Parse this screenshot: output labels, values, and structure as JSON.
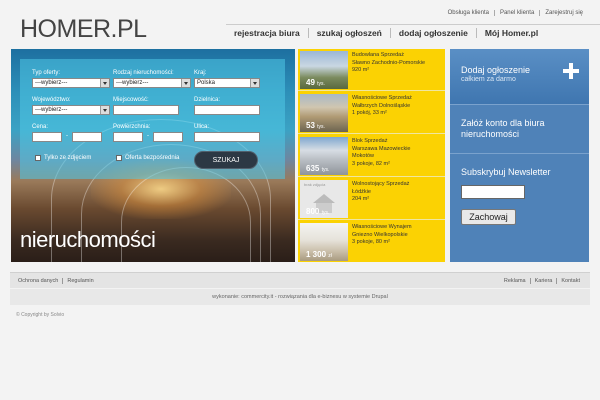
{
  "header": {
    "logo": "HOMER.PL",
    "top_links": [
      "Obsługa klienta",
      "Panel klienta",
      "Zarejestruj się"
    ],
    "nav": [
      "rejestracja biura",
      "szukaj ogłoszeń",
      "dodaj ogłoszenie",
      "Mój Homer.pl"
    ]
  },
  "search": {
    "offer_type": {
      "label": "Typ oferty:",
      "value": "---wybierz---"
    },
    "property_type": {
      "label": "Rodzaj nieruchomości:",
      "value": "---wybierz---"
    },
    "country": {
      "label": "Kraj:",
      "value": "Polska"
    },
    "voivodeship": {
      "label": "Województwo:",
      "value": "---wybierz---"
    },
    "city": {
      "label": "Miejscowość:",
      "value": ""
    },
    "district": {
      "label": "Dzielnica:",
      "value": ""
    },
    "price": {
      "label": "Cena:",
      "separator": "-"
    },
    "area": {
      "label": "Powierzchnia:",
      "separator": "-"
    },
    "street": {
      "label": "Ulica:",
      "value": ""
    },
    "with_photos_label": "Tylko ze zdjęciem",
    "direct_offer_label": "Oferta bezpośrednia",
    "submit_label": "SZUKAJ",
    "hero_title": "nieruchomości"
  },
  "listings": [
    {
      "price": "49",
      "unit": "tys.",
      "lines": [
        "Budowlana Sprzedaż",
        "Sławno Zachodnio-Pomorskie",
        "920 m²"
      ]
    },
    {
      "price": "53",
      "unit": "tys.",
      "lines": [
        "Własnościowe Sprzedaż",
        "Wałbrzych Dolnośląskie",
        "1 pokój, 33 m²"
      ]
    },
    {
      "price": "635",
      "unit": "tys.",
      "lines": [
        "Blok Sprzedaż",
        "Warszawa Mazowieckie",
        "Mokotów",
        "3 pokoje, 82 m²"
      ]
    },
    {
      "price": "800",
      "unit": "tys.",
      "badge": "brak zdjęcia",
      "lines": [
        "Wolnostojący Sprzedaż",
        "Łódźkie",
        "204 m²"
      ]
    },
    {
      "price": "1 300",
      "unit": "zł",
      "lines": [
        "Własnościowe Wynajem",
        "Gniezno Wielkopolskie",
        "3 pokoje, 80 m²"
      ]
    }
  ],
  "sidebar": {
    "add_title": "Dodaj ogłoszenie",
    "add_subtitle": "całkiem za darmo",
    "account_text": "Załóż konto dla biura nieruchomości",
    "newsletter_title": "Subskrybuj Newsletter",
    "newsletter_value": "",
    "newsletter_button": "Zachowaj"
  },
  "footer": {
    "left_links": [
      "Ochrona danych",
      "Regulamin"
    ],
    "right_links": [
      "Reklama",
      "Kariera",
      "Kontakt"
    ],
    "credit": "wykonanie: commercity.it - rozwiązania dla e-biznesu w systemie Drupal",
    "copyright": "© Copyright by Solvio"
  },
  "colors": {
    "listings_bg": "#fbd203",
    "sidebar_bg": "#4f82b8",
    "search_panel": "#50c8e6"
  }
}
